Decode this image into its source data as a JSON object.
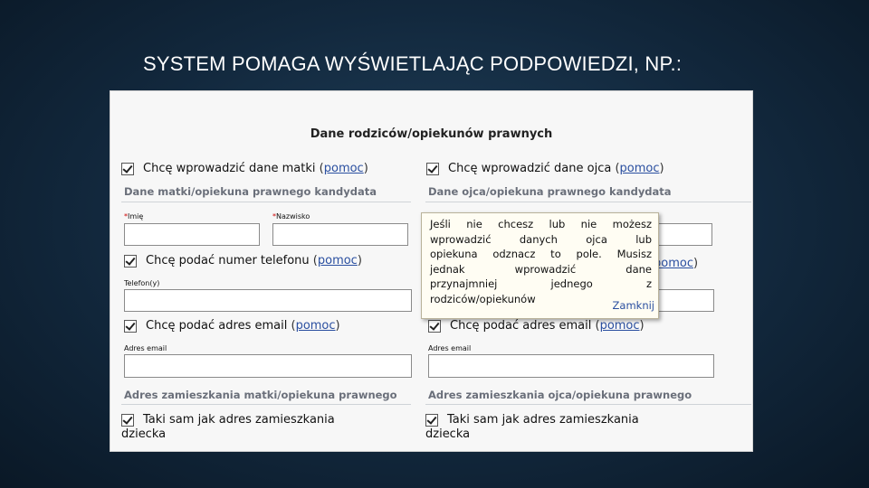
{
  "slide": {
    "title": "SYSTEM POMAGA WYŚWIETLAJĄC PODPOWIEDZI, NP.:"
  },
  "form": {
    "title": "Dane rodziców/opiekunów prawnych",
    "help_link": "pomoc",
    "mother": {
      "checkbox_label": "Chcę wprowadzić dane matki",
      "section_label": "Dane matki/opiekuna prawnego kandydata",
      "first_name_label": "Imię",
      "last_name_label": "Nazwisko",
      "phone_checkbox_label": "Chcę podać numer telefonu",
      "phone_label": "Telefon(y)",
      "email_checkbox_label": "Chcę podać adres email",
      "email_label": "Adres email",
      "address_section_label": "Adres zamieszkania matki/opiekuna prawnego",
      "same_address_label": "Taki sam jak adres zamieszkania",
      "same_address_label_cont": "dziecka"
    },
    "father": {
      "checkbox_label": "Chcę wprowadzić dane ojca",
      "section_label": "Dane ojca/opiekuna prawnego kandydata",
      "email_checkbox_label": "Chcę podać adres email",
      "email_label": "Adres email",
      "address_section_label": "Adres zamieszkania ojca/opiekuna prawnego",
      "same_address_label": "Taki sam jak adres zamieszkania",
      "same_address_label_cont": "dziecka"
    },
    "tooltip": {
      "lines": [
        "Jeśli nie chcesz lub nie możesz",
        "wprowadzić danych ojca lub",
        "opiekuna odznacz to pole. Musisz",
        "jednak wprowadzić dane",
        "przynajmniej jednego z",
        "rodziców/opiekunów"
      ],
      "close_label": "Zamknij"
    },
    "required_mark": "*"
  }
}
